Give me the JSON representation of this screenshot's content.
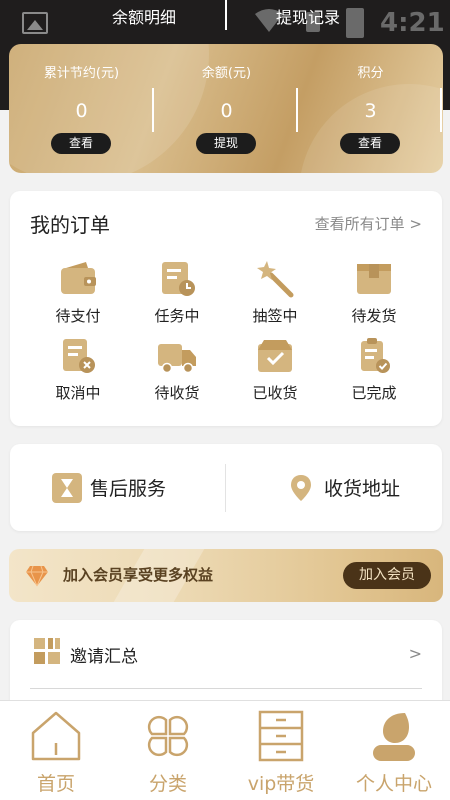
{
  "status_bar": {
    "time": "4:21"
  },
  "header": {
    "balance_detail": "余额明细",
    "withdraw_record": "提现记录"
  },
  "stats": [
    {
      "label": "累计节约(元)",
      "value": "0",
      "button": "查看"
    },
    {
      "label": "余额(元)",
      "value": "0",
      "button": "提现"
    },
    {
      "label": "积分",
      "value": "3",
      "button": "查看"
    }
  ],
  "orders": {
    "title": "我的订单",
    "view_all": "查看所有订单 >",
    "items": [
      {
        "label": "待支付",
        "icon": "wallet-icon"
      },
      {
        "label": "任务中",
        "icon": "task-clock-icon"
      },
      {
        "label": "抽签中",
        "icon": "magic-wand-icon"
      },
      {
        "label": "待发货",
        "icon": "box-icon"
      },
      {
        "label": "取消中",
        "icon": "document-cancel-icon"
      },
      {
        "label": "待收货",
        "icon": "truck-icon"
      },
      {
        "label": "已收货",
        "icon": "box-check-icon"
      },
      {
        "label": "已完成",
        "icon": "clipboard-check-icon"
      }
    ]
  },
  "services": {
    "after_sales": "售后服务",
    "address": "收货地址"
  },
  "member": {
    "text": "加入会员享受更多权益",
    "button": "加入会员"
  },
  "invite": {
    "label": "邀请汇总",
    "arrow": ">"
  },
  "nav": [
    {
      "label": "首页",
      "icon": "home-icon"
    },
    {
      "label": "分类",
      "icon": "category-icon"
    },
    {
      "label": "vip带货",
      "icon": "cabinet-icon"
    },
    {
      "label": "个人中心",
      "icon": "user-icon"
    }
  ],
  "colors": {
    "gold": "#c9a46c",
    "dark": "#1f1d1d",
    "member_button": "#4a3318"
  }
}
